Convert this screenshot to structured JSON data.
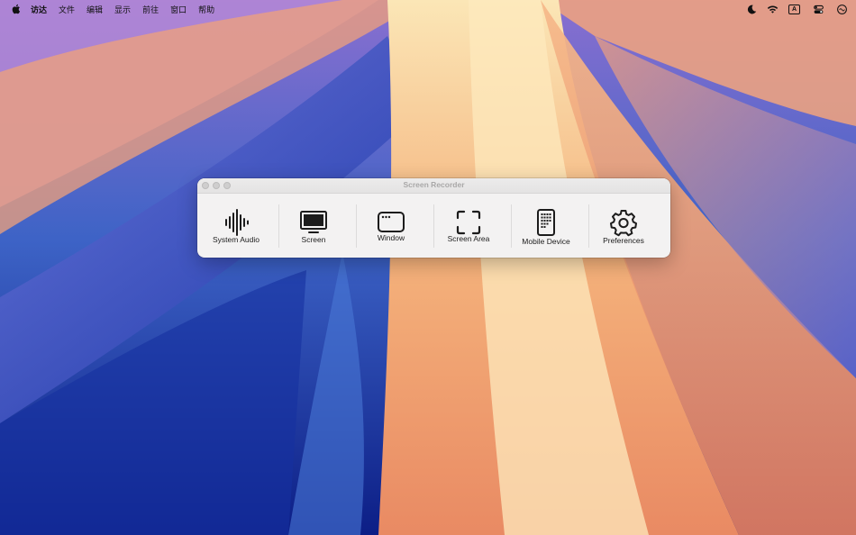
{
  "menubar": {
    "items": [
      {
        "label": "访达",
        "app": true
      },
      {
        "label": "文件"
      },
      {
        "label": "编辑"
      },
      {
        "label": "显示"
      },
      {
        "label": "前往"
      },
      {
        "label": "窗口"
      },
      {
        "label": "帮助"
      }
    ],
    "status_icons": [
      "moon-icon",
      "wifi-icon",
      "input-source-icon",
      "control-center-icon",
      "siri-icon"
    ],
    "input_source_label": "A"
  },
  "window": {
    "title": "Screen Recorder",
    "tools": [
      {
        "label": "System Audio",
        "icon": "waveform-icon"
      },
      {
        "label": "Screen",
        "icon": "display-icon"
      },
      {
        "label": "Window",
        "icon": "window-icon"
      },
      {
        "label": "Screen Area",
        "icon": "crop-frame-icon"
      },
      {
        "label": "Mobile Device",
        "icon": "phone-icon"
      },
      {
        "label": "Preferences",
        "icon": "gear-icon"
      }
    ]
  }
}
